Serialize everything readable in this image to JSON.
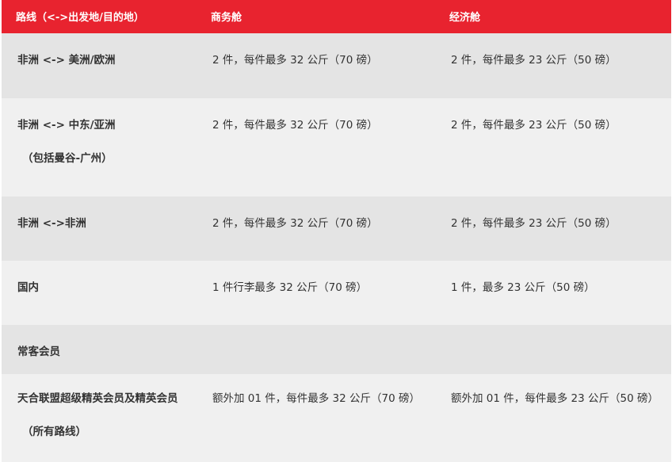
{
  "header": {
    "route": "路线（<->出发地/目的地）",
    "business": "商务舱",
    "economy": "经济舱"
  },
  "rows": [
    {
      "route": "非洲 <-> 美洲/欧洲",
      "route_sub": "",
      "business": "2 件，每件最多 32 公斤（70 磅）",
      "economy": "2 件，每件最多 23 公斤（50 磅）"
    },
    {
      "route": "非洲 <-> 中东/亚洲",
      "route_sub": "（包括曼谷-广州）",
      "business": "2 件，每件最多 32 公斤（70 磅）",
      "economy": "2 件，每件最多 23 公斤（50 磅）"
    },
    {
      "route": "非洲 <->非洲",
      "route_sub": "",
      "business": "2 件，每件最多 32 公斤（70 磅）",
      "economy": "2 件，每件最多 23 公斤（50 磅）"
    },
    {
      "route": "国内",
      "route_sub": "",
      "business": "1 件行李最多 32 公斤（70 磅）",
      "economy": "1 件，最多 23 公斤（50 磅）"
    },
    {
      "route": "常客会员",
      "route_sub": "",
      "business": "",
      "economy": ""
    },
    {
      "route": "天合联盟超级精英会员及精英会员",
      "route_sub": "（所有路线）",
      "business": "额外加 01 件，每件最多 32 公斤（70 磅）",
      "economy": "额外加 01 件，每件最多 23 公斤（50 磅）"
    }
  ],
  "colors": {
    "header_bg": "#e8232f",
    "row_dark": "#e4e4e4",
    "row_light": "#f0f0f0"
  }
}
